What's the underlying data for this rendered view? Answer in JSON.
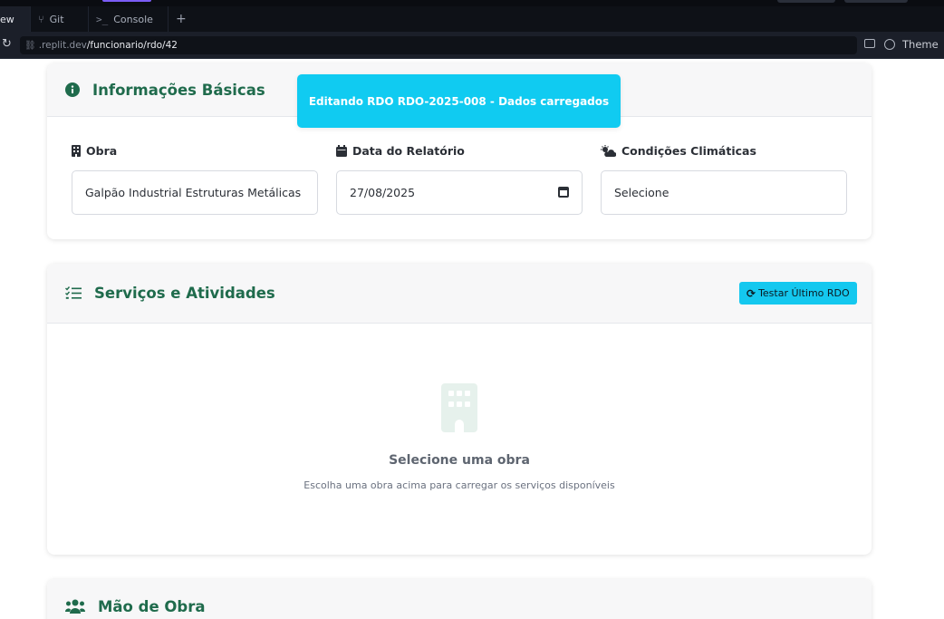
{
  "browser": {
    "tabs": [
      {
        "label": "ew",
        "icon": "preview-icon"
      },
      {
        "label": "Git",
        "icon": "git-branch-icon"
      },
      {
        "label": "Console",
        "icon": "terminal-icon"
      }
    ],
    "new_tab_label": "+",
    "url_host": ".replit.dev",
    "url_path": "/funcionario/rdo/42",
    "theme_label": "Theme"
  },
  "toast": {
    "message": "Editando RDO RDO-2025-008 - Dados carregados",
    "color": "#10cbf1"
  },
  "basic_info": {
    "title": "Informações Básicas",
    "icon": "info-circle-icon",
    "fields": {
      "obra": {
        "label": "Obra",
        "value": "Galpão Industrial Estruturas Metálicas",
        "icon": "building-icon"
      },
      "data": {
        "label": "Data do Relatório",
        "value": "27/08/2025",
        "icon": "calendar-icon"
      },
      "clima": {
        "label": "Condições Climáticas",
        "value": "Selecione",
        "icon": "cloud-sun-icon"
      }
    }
  },
  "services": {
    "title": "Serviços e Atividades",
    "icon": "tasks-icon",
    "test_button_label": "Testar Último RDO",
    "empty_title": "Selecione uma obra",
    "empty_description": "Escolha uma obra acima para carregar os serviços disponíveis"
  },
  "labor": {
    "title": "Mão de Obra",
    "icon": "users-icon"
  },
  "colors": {
    "accent_green": "#1f6b4c",
    "info_blue": "#14c8ef"
  }
}
